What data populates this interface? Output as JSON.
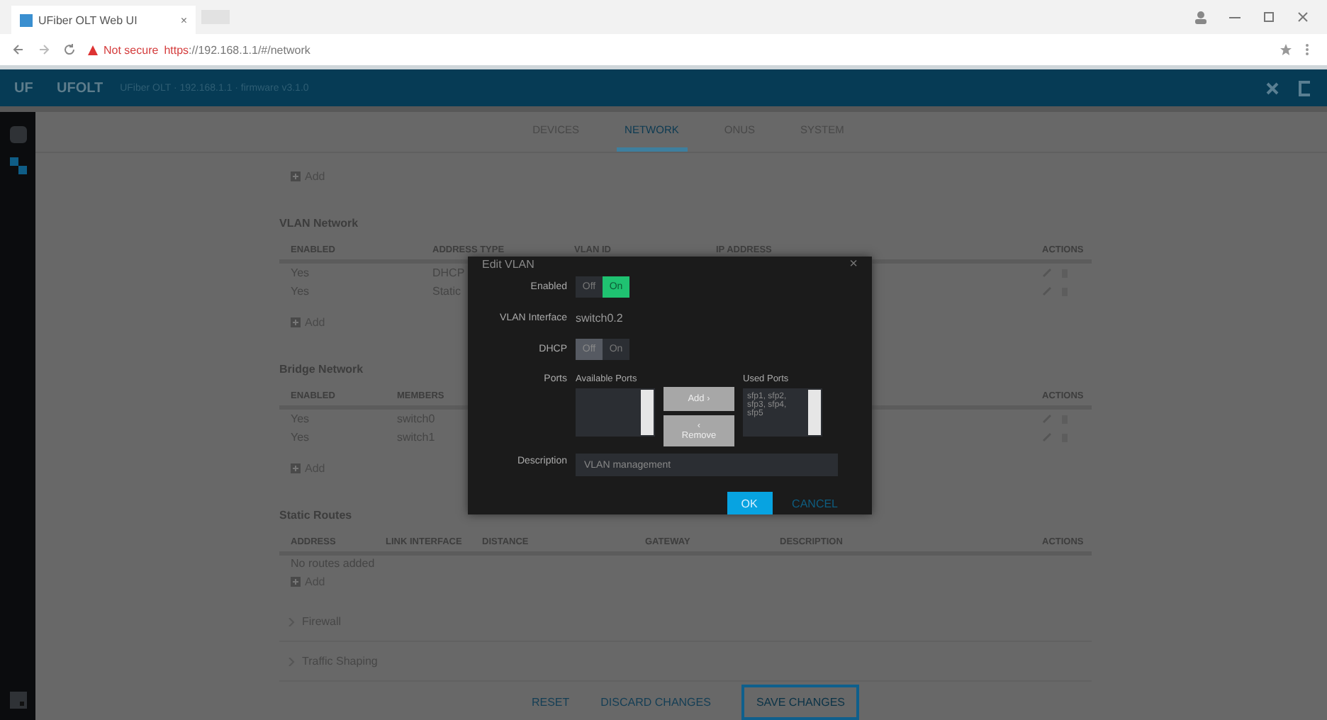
{
  "browser": {
    "tab_title": "UFiber OLT Web UI",
    "tab_close": "×",
    "address_warning": "Not secure",
    "address_scheme": "https",
    "address_rest": "://192.168.1.1/#/network"
  },
  "header": {
    "logo": "UF",
    "title": "UFOLT",
    "subtitle": "UFiber OLT · 192.168.1.1 · firmware v3.1.0"
  },
  "tabs": [
    {
      "label": "DEVICES",
      "selected": false
    },
    {
      "label": "NETWORK",
      "selected": true
    },
    {
      "label": "ONUS",
      "selected": false
    },
    {
      "label": "SYSTEM",
      "selected": false
    }
  ],
  "top_add": "Add",
  "sections": [
    {
      "title": "VLAN Network",
      "columns": [
        "ENABLED",
        "ADDRESS TYPE",
        "VLAN ID",
        "IP ADDRESS",
        "ACTIONS"
      ],
      "rows": [
        {
          "cells": [
            "Yes",
            "DHCP"
          ]
        },
        {
          "cells": [
            "Yes",
            "Static"
          ]
        }
      ],
      "add_label": "Add"
    },
    {
      "title": "Bridge Network",
      "columns": [
        "ENABLED",
        "MEMBERS",
        "",
        "",
        "ACTIONS"
      ],
      "rows": [
        {
          "cells": [
            "Yes",
            "switch0"
          ]
        },
        {
          "cells": [
            "Yes",
            "switch1"
          ]
        }
      ],
      "add_label": "Add"
    },
    {
      "title": "Static Routes",
      "columns": [
        "ADDRESS",
        "LINK INTERFACE",
        "DISTANCE",
        "GATEWAY",
        "DESCRIPTION",
        "ACTIONS"
      ],
      "empty_text": "No routes added",
      "add_label": "Add"
    }
  ],
  "collapsibles": [
    {
      "label": "Firewall",
      "expanded": false
    },
    {
      "label": "Traffic Shaping",
      "expanded": false
    }
  ],
  "footer": {
    "reset": "RESET",
    "discard": "DISCARD CHANGES",
    "save": "SAVE CHANGES"
  },
  "dialog": {
    "title": "Edit VLAN",
    "close": "×",
    "enabled": {
      "label": "Enabled",
      "options": [
        {
          "label": "Off",
          "selected": false
        },
        {
          "label": "On",
          "selected": true
        }
      ]
    },
    "interface": {
      "label": "VLAN Interface",
      "value": "switch0.2"
    },
    "dhcp": {
      "label": "DHCP",
      "options": [
        {
          "label": "Off",
          "selected": true
        },
        {
          "label": "On",
          "selected": false
        }
      ]
    },
    "ports": {
      "label": "Ports",
      "available_label": "Available Ports",
      "used_label": "Used Ports",
      "used_items": "sfp1, sfp2, sfp3, sfp4, sfp5",
      "add": "Add ›",
      "remove_icon": "‹",
      "remove": "Remove"
    },
    "description": {
      "label": "Description",
      "value": "VLAN management"
    },
    "ok": "OK",
    "cancel": "CANCEL"
  }
}
